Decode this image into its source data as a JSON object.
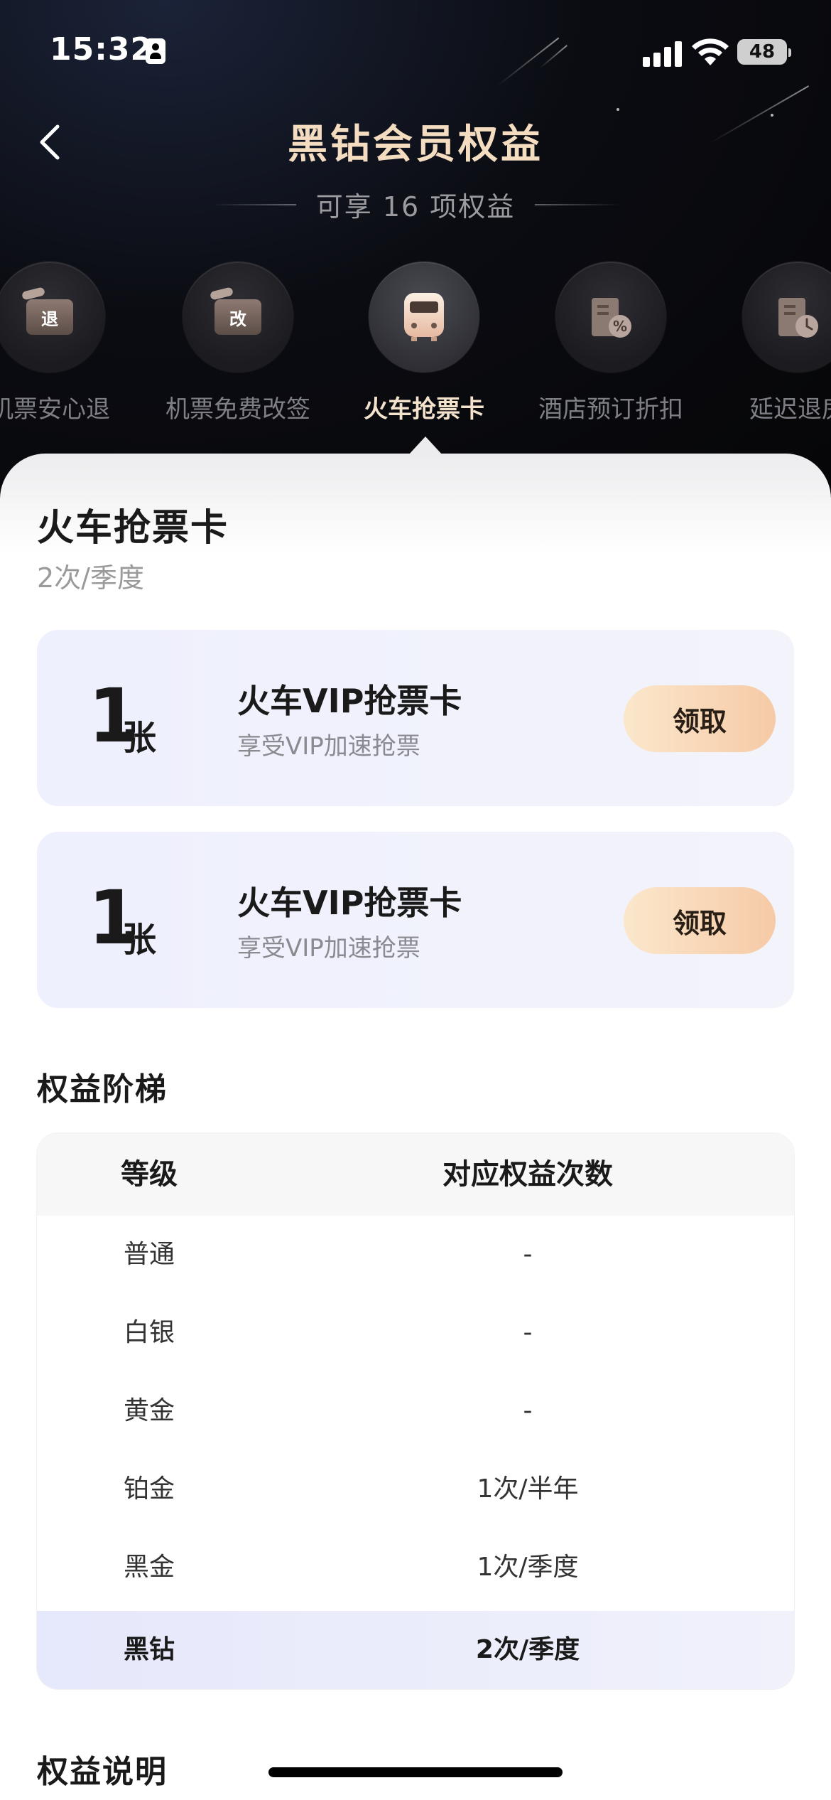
{
  "status_bar": {
    "time": "15:32",
    "battery": "48"
  },
  "header": {
    "title": "黑钻会员权益",
    "subtitle": "可享 16 项权益"
  },
  "benefits": [
    {
      "label": "机票安心退",
      "glyph": "退",
      "icon": "refund-ticket-icon"
    },
    {
      "label": "机票免费改签",
      "glyph": "改",
      "icon": "change-ticket-icon"
    },
    {
      "label": "火车抢票卡",
      "icon": "train-icon",
      "active": true
    },
    {
      "label": "酒店预订折扣",
      "icon": "hotel-discount-icon"
    },
    {
      "label": "延迟退房",
      "icon": "late-checkout-icon"
    }
  ],
  "detail": {
    "title": "火车抢票卡",
    "frequency": "2次/季度",
    "cards": [
      {
        "count": "1",
        "unit": "张",
        "name": "火车VIP抢票卡",
        "desc": "享受VIP加速抢票",
        "button": "领取"
      },
      {
        "count": "1",
        "unit": "张",
        "name": "火车VIP抢票卡",
        "desc": "享受VIP加速抢票",
        "button": "领取"
      }
    ]
  },
  "ladder": {
    "title": "权益阶梯",
    "headers": [
      "等级",
      "对应权益次数"
    ],
    "rows": [
      {
        "level": "普通",
        "count": "-"
      },
      {
        "level": "白银",
        "count": "-"
      },
      {
        "level": "黄金",
        "count": "-"
      },
      {
        "level": "铂金",
        "count": "1次/半年"
      },
      {
        "level": "黑金",
        "count": "1次/季度"
      },
      {
        "level": "黑钻",
        "count": "2次/季度",
        "highlight": true
      }
    ]
  },
  "explain_title": "权益说明",
  "colors": {
    "title_gold": "#f3dcbf",
    "claim_gradient_start": "#fbe7cc",
    "claim_gradient_end": "#f6caa6",
    "highlight_row": "#e6e8fb"
  }
}
